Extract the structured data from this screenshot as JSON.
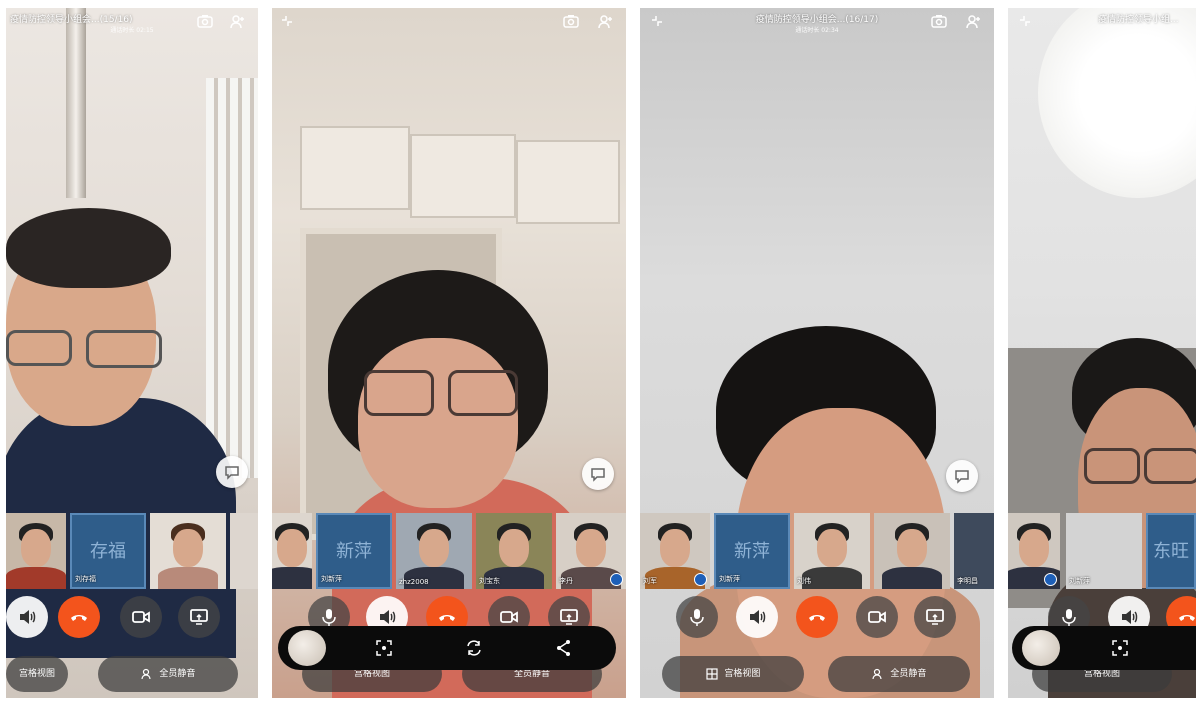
{
  "panels": [
    {
      "title": "疫情防控领导小组会...(15/16)",
      "subtitle": "通话时长 02:15",
      "thumbnails": [
        {
          "type": "video",
          "name": ""
        },
        {
          "type": "avatar",
          "avatar_text": "存福",
          "name": "刘存福"
        },
        {
          "type": "video",
          "name": ""
        },
        {
          "type": "video",
          "name": ""
        }
      ],
      "bottom": {
        "layout_label": "宫格视图",
        "mute_all_label": "全员静音"
      }
    },
    {
      "title": "",
      "subtitle": "",
      "thumbnails": [
        {
          "type": "video",
          "name": ""
        },
        {
          "type": "avatar",
          "avatar_text": "新萍",
          "name": "刘新萍"
        },
        {
          "type": "video",
          "name": "zhz2008"
        },
        {
          "type": "video",
          "name": "刘宝东"
        },
        {
          "type": "video",
          "name": "李丹"
        }
      ],
      "bottom": {
        "layout_label": "宫格视图",
        "mute_all_label": "全员静音"
      }
    },
    {
      "title": "疫情防控领导小组会...(16/17)",
      "subtitle": "通话时长 02:34",
      "thumbnails": [
        {
          "type": "video",
          "name": "刘军"
        },
        {
          "type": "avatar",
          "avatar_text": "新萍",
          "name": "刘新萍"
        },
        {
          "type": "video",
          "name": "刘伟"
        },
        {
          "type": "video",
          "name": ""
        },
        {
          "type": "video",
          "name": "李明昌"
        }
      ],
      "bottom": {
        "layout_label": "宫格视图",
        "mute_all_label": "全员静音"
      }
    },
    {
      "title": "疫情防控领导小组...",
      "subtitle": "",
      "thumbnails": [
        {
          "type": "video",
          "name": ""
        },
        {
          "type": "video",
          "name": "刘新萍"
        },
        {
          "type": "avatar",
          "avatar_text": "东旺",
          "name": ""
        }
      ],
      "bottom": {
        "layout_label": "宫格视图",
        "mute_all_label": ""
      }
    }
  ],
  "colors": {
    "hangup": "#f3541c",
    "avatar_bg": "#2f5d8a",
    "overlay_bg": "#0b0b0b"
  },
  "icons": [
    "shrink-icon",
    "camera-switch-icon",
    "add-person-icon",
    "speaker-icon",
    "hangup-icon",
    "video-icon",
    "screen-share-icon",
    "mic-icon",
    "grid-icon",
    "mute-all-icon",
    "scan-icon",
    "rotate-icon",
    "share-icon",
    "chat-icon"
  ]
}
